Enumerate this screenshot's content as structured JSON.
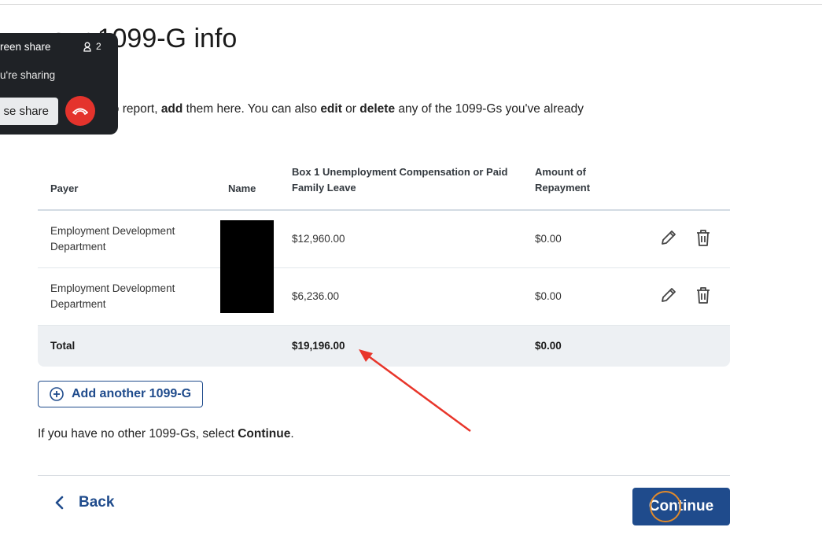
{
  "page": {
    "title": "your 1099-G info",
    "intro": {
      "part1": "ore 1099-Gs to report, ",
      "add": "add",
      "part2": " them here. You can also ",
      "edit": "edit",
      "part3": " or ",
      "delete": "delete",
      "part4": " any of the 1099-Gs you've already"
    }
  },
  "table": {
    "headers": {
      "payer": "Payer",
      "name": "Name",
      "box1": "Box 1 Unemployment Compensation or Paid Family Leave",
      "repayment": "Amount of Repayment"
    },
    "rows": [
      {
        "payer": "Employment Development Department",
        "box1": "$12,960.00",
        "repayment": "$0.00"
      },
      {
        "payer": "Employment Development Department",
        "box1": "$6,236.00",
        "repayment": "$0.00"
      }
    ],
    "total": {
      "label": "Total",
      "box1": "$19,196.00",
      "repayment": "$0.00"
    }
  },
  "actions": {
    "add_another": "Add another 1099-G",
    "hint_prefix": "If you have no other 1099-Gs, select ",
    "hint_strong": "Continue",
    "hint_suffix": ".",
    "back": "Back",
    "continue": "Continue"
  },
  "screen_share": {
    "title": "reen share",
    "viewer_count": "2",
    "subtitle": "u're sharing",
    "pause": "se share"
  },
  "colors": {
    "primary": "#1f4b8c",
    "annotation_arrow": "#e8352a",
    "end_call": "#e4332c"
  },
  "icons": [
    "edit-pencil-icon",
    "trash-icon",
    "plus-circle-icon",
    "chevron-left-icon",
    "person-icon",
    "hang-up-phone-icon"
  ]
}
